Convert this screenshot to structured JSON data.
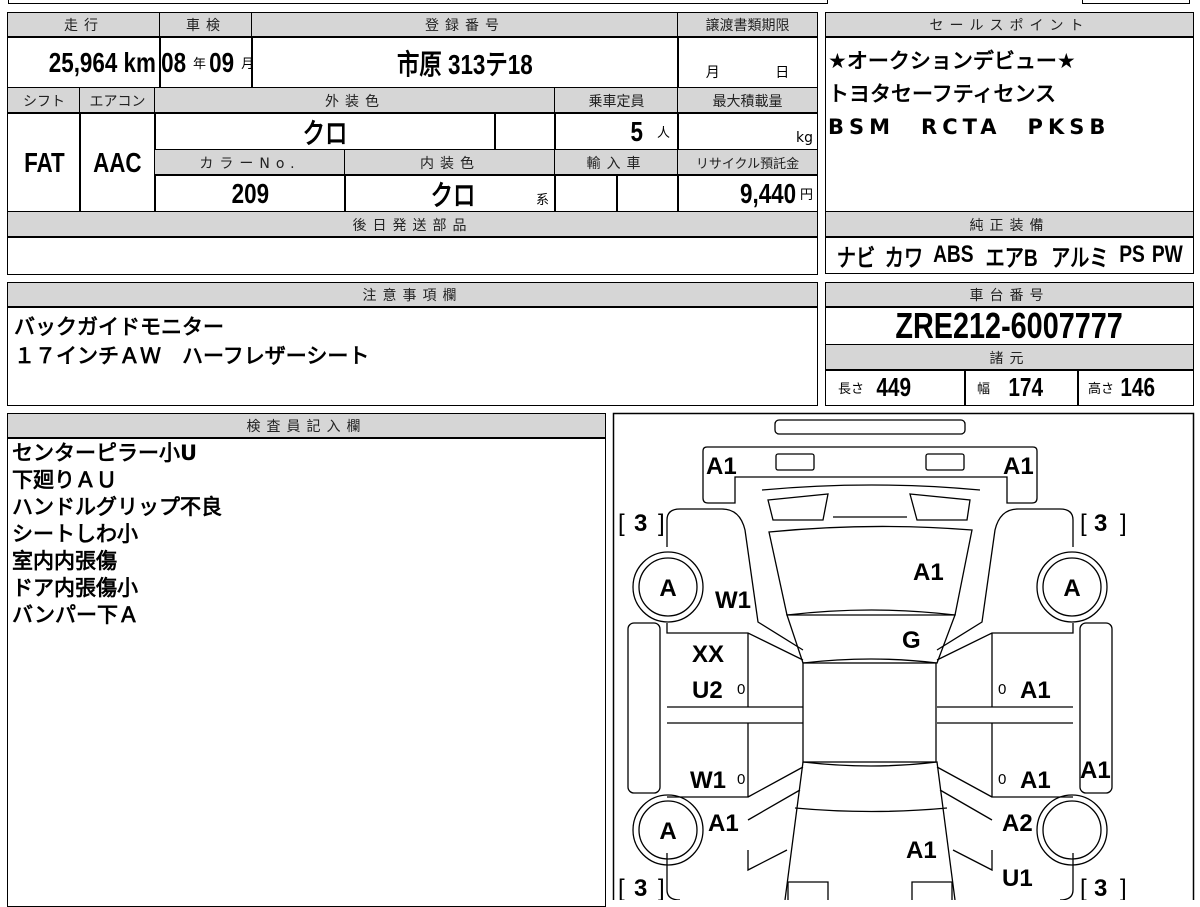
{
  "vehicle": {
    "mileage_label": "走行",
    "mileage": "25,964",
    "mileage_unit": "km",
    "inspection_label": "車検",
    "inspection_year": "08",
    "year_unit": "年",
    "inspection_month": "09",
    "month_unit": "月",
    "registration_label": "登録番号",
    "registration": "市原 313テ18",
    "transfer_deadline_label": "譲渡書類期限",
    "transfer_month_unit": "月",
    "transfer_day_unit": "日",
    "shift_label": "シフト",
    "shift": "FAT",
    "ac_label": "エアコン",
    "ac": "AAC",
    "exterior_color_label": "外装色",
    "exterior_color": "クロ",
    "capacity_label": "乗車定員",
    "capacity": "5",
    "capacity_unit": "人",
    "max_load_label": "最大積載量",
    "max_load_unit": "kg",
    "color_no_label": "カラーNo.",
    "color_no": "209",
    "interior_color_label": "内装色",
    "interior_color": "クロ",
    "interior_suffix": "系",
    "import_label": "輸入車",
    "recycle_label": "リサイクル預託金",
    "recycle_fee": "9,440",
    "recycle_unit": "円",
    "later_parts_label": "後日発送部品"
  },
  "sales_points": {
    "label": "セールスポイント",
    "lines": [
      "★オークションデビュー★",
      "トヨタセーフティセンス",
      "BSM　RCTA　PKSB"
    ]
  },
  "equipment": {
    "label": "純正装備",
    "items": [
      "ナビ",
      "カワ",
      "ABS",
      "エアB",
      "アルミ",
      "PS",
      "PW"
    ]
  },
  "notes": {
    "label": "注意事項欄",
    "lines": [
      "バックガイドモニター",
      "１７インチＡＷ　ハーフレザーシート"
    ]
  },
  "chassis": {
    "label": "車台番号",
    "number": "ZRE212-6007777"
  },
  "specs": {
    "label": "諸元",
    "length_label": "長さ",
    "length": "449",
    "width_label": "幅",
    "width": "174",
    "height_label": "高さ",
    "height": "146"
  },
  "inspector": {
    "label": "検査員記入欄",
    "lines": [
      "センターピラー小U",
      "下廻りＡＵ",
      "ハンドルグリップ不良",
      "シートしわ小",
      "室内内張傷",
      "ドア内張傷小",
      "バンパー下Ａ"
    ]
  },
  "diagram": {
    "front_left": "A1",
    "front_right": "A1",
    "hood": "A1",
    "windshield_left": "W1",
    "roof": "G",
    "left_front_door_1": "XX",
    "left_front_door_2": "U2",
    "right_front_door": "A1",
    "left_rear_door": "W1",
    "right_rear_door": "A1",
    "right_sill": "A1",
    "left_rear_fender": "A1",
    "right_rear_fender": "A2",
    "trunk": "A1",
    "rear_right": "U1",
    "tire_fl": "A",
    "tire_fr": "A",
    "tire_rl": "A",
    "tread": "3",
    "door_mark": "0"
  }
}
